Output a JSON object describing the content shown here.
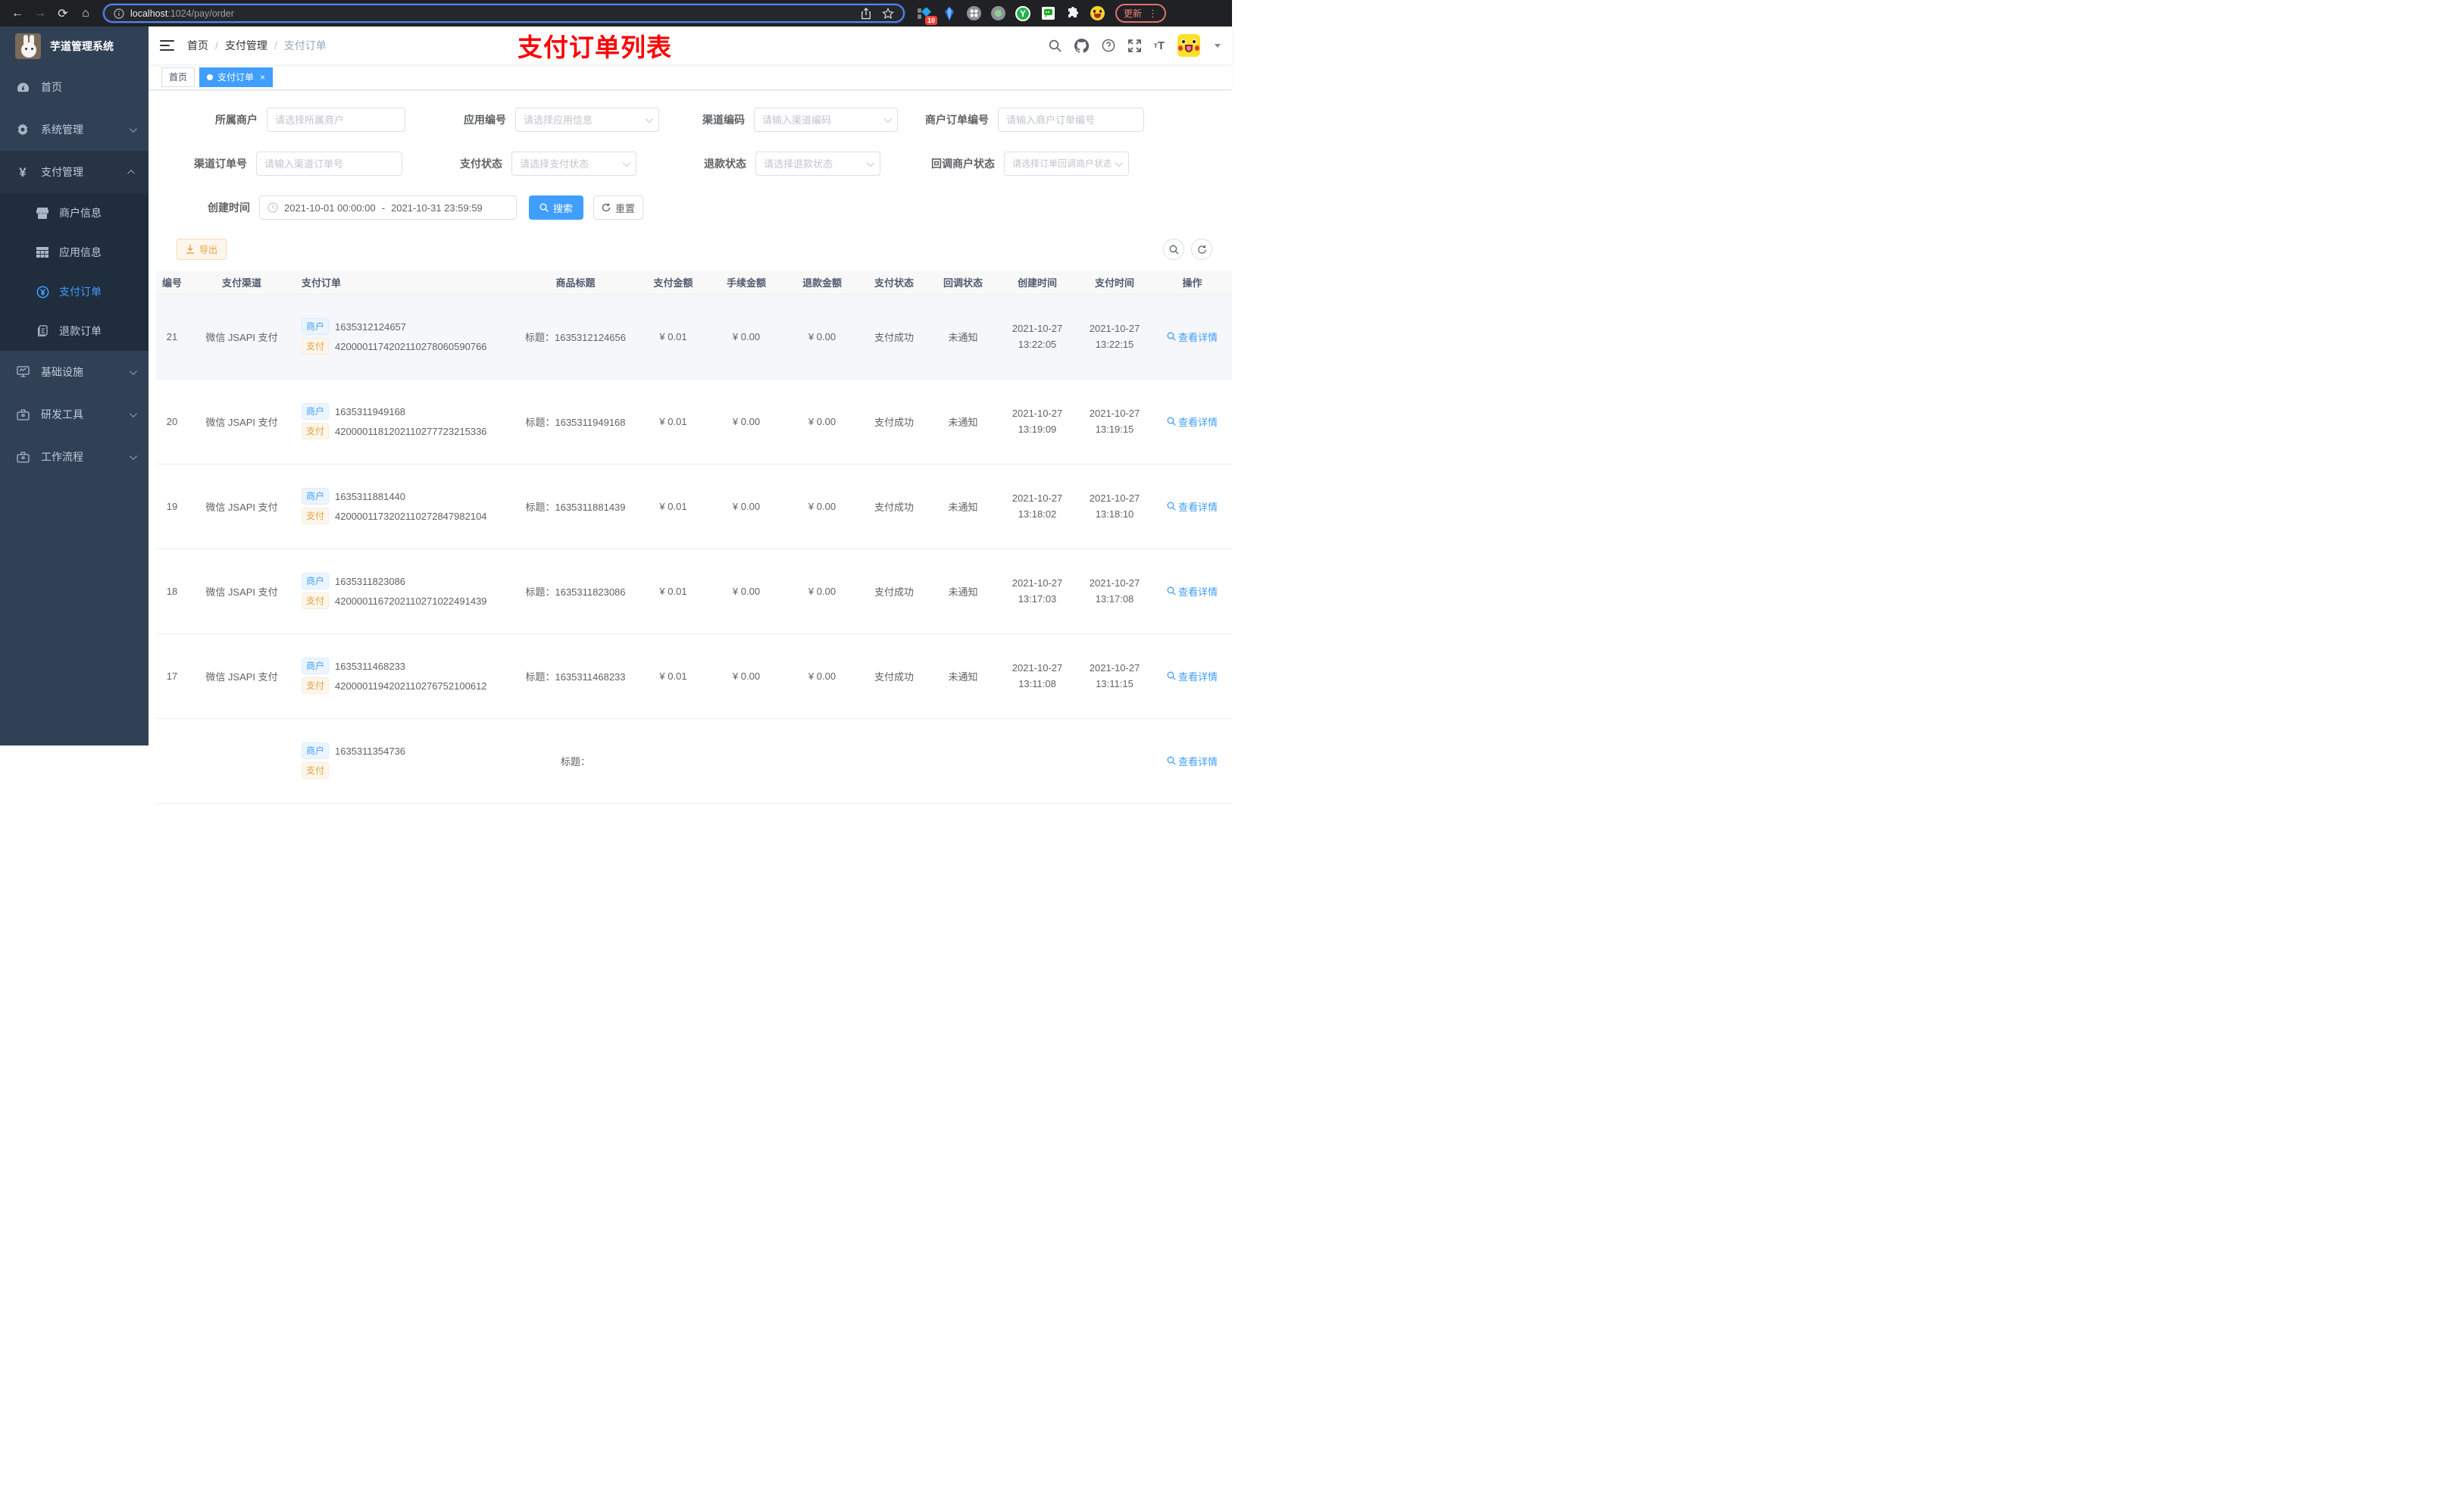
{
  "browser": {
    "url_host": "localhost",
    "url_rest": ":1024/pay/order",
    "extension_badge": "10",
    "update_label": "更新",
    "extension_icons": [
      "diamond-badge",
      "gem",
      "clover",
      "record-dot",
      "y-circle",
      "chat",
      "puzzle",
      "emoji-face"
    ]
  },
  "sidebar": {
    "logo_title": "芋道管理系统",
    "menu": [
      {
        "label": "首页",
        "icon": "dashboard-icon"
      },
      {
        "label": "系统管理",
        "icon": "gear-icon"
      },
      {
        "label": "支付管理",
        "icon": "yen-icon"
      },
      {
        "label": "商户信息",
        "icon": "shop-icon"
      },
      {
        "label": "应用信息",
        "icon": "grid-icon"
      },
      {
        "label": "支付订单",
        "icon": "pay-circle-icon"
      },
      {
        "label": "退款订单",
        "icon": "document-icon"
      },
      {
        "label": "基础设施",
        "icon": "monitor-icon"
      },
      {
        "label": "研发工具",
        "icon": "briefcase-icon"
      },
      {
        "label": "工作流程",
        "icon": "briefcase-icon"
      }
    ]
  },
  "header": {
    "breadcrumb": [
      "首页",
      "支付管理",
      "支付订单"
    ],
    "breadcrumb_sep": "/",
    "annotation": "支付订单列表",
    "right_icons": [
      "search-icon",
      "github-icon",
      "help-icon",
      "fullscreen-icon",
      "font-size-icon",
      "avatar",
      "caret-down-icon"
    ]
  },
  "tabs": [
    {
      "label": "首页",
      "active": false
    },
    {
      "label": "支付订单",
      "active": true,
      "close": "×"
    }
  ],
  "filters": {
    "fields": [
      {
        "label": "所属商户",
        "placeholder": "请选择所属商户",
        "select": false
      },
      {
        "label": "应用编号",
        "placeholder": "请选择应用信息",
        "select": true
      },
      {
        "label": "渠道编码",
        "placeholder": "请输入渠道编码",
        "select": true
      },
      {
        "label": "商户订单编号",
        "placeholder": "请输入商户订单编号",
        "select": false
      },
      {
        "label": "渠道订单号",
        "placeholder": "请输入渠道订单号",
        "select": false
      },
      {
        "label": "支付状态",
        "placeholder": "请选择支付状态",
        "select": true
      },
      {
        "label": "退款状态",
        "placeholder": "请选择退款状态",
        "select": true
      },
      {
        "label": "回调商户状态",
        "placeholder": "请选择订单回调商户状态",
        "select": true
      }
    ],
    "date": {
      "label": "创建时间",
      "start": "2021-10-01 00:00:00",
      "separator": "-",
      "end": "2021-10-31 23:59:59"
    },
    "search_label": "搜索",
    "reset_label": "重置"
  },
  "toolbar": {
    "export_label": "导出"
  },
  "table": {
    "columns": [
      "编号",
      "支付渠道",
      "支付订单",
      "商品标题",
      "支付金额",
      "手续金额",
      "退款金额",
      "支付状态",
      "回调状态",
      "创建时间",
      "支付时间",
      "操作"
    ],
    "tag_merchant": "商户",
    "tag_pay": "支付",
    "title_prefix": "标题：",
    "action_label": "查看详情",
    "rows": [
      {
        "id": "21",
        "channel": "微信 JSAPI 支付",
        "merchant_no": "1635312124657",
        "pay_no": "4200001174202110278060590766",
        "title": "1635312124656",
        "amount": "¥ 0.01",
        "fee": "¥ 0.00",
        "refund": "¥ 0.00",
        "status": "支付成功",
        "notify": "未通知",
        "created_date": "2021-10-27",
        "created_time": "13:22:05",
        "paid_date": "2021-10-27",
        "paid_time": "13:22:15",
        "highlight": true
      },
      {
        "id": "20",
        "channel": "微信 JSAPI 支付",
        "merchant_no": "1635311949168",
        "pay_no": "4200001181202110277723215336",
        "title": "1635311949168",
        "amount": "¥ 0.01",
        "fee": "¥ 0.00",
        "refund": "¥ 0.00",
        "status": "支付成功",
        "notify": "未通知",
        "created_date": "2021-10-27",
        "created_time": "13:19:09",
        "paid_date": "2021-10-27",
        "paid_time": "13:19:15"
      },
      {
        "id": "19",
        "channel": "微信 JSAPI 支付",
        "merchant_no": "1635311881440",
        "pay_no": "4200001173202110272847982104",
        "title": "1635311881439",
        "amount": "¥ 0.01",
        "fee": "¥ 0.00",
        "refund": "¥ 0.00",
        "status": "支付成功",
        "notify": "未通知",
        "created_date": "2021-10-27",
        "created_time": "13:18:02",
        "paid_date": "2021-10-27",
        "paid_time": "13:18:10"
      },
      {
        "id": "18",
        "channel": "微信 JSAPI 支付",
        "merchant_no": "1635311823086",
        "pay_no": "4200001167202110271022491439",
        "title": "1635311823086",
        "amount": "¥ 0.01",
        "fee": "¥ 0.00",
        "refund": "¥ 0.00",
        "status": "支付成功",
        "notify": "未通知",
        "created_date": "2021-10-27",
        "created_time": "13:17:03",
        "paid_date": "2021-10-27",
        "paid_time": "13:17:08"
      },
      {
        "id": "17",
        "channel": "微信 JSAPI 支付",
        "merchant_no": "1635311468233",
        "pay_no": "4200001194202110276752100612",
        "title": "1635311468233",
        "amount": "¥ 0.01",
        "fee": "¥ 0.00",
        "refund": "¥ 0.00",
        "status": "支付成功",
        "notify": "未通知",
        "created_date": "2021-10-27",
        "created_time": "13:11:08",
        "paid_date": "2021-10-27",
        "paid_time": "13:11:15"
      },
      {
        "id": "",
        "channel": "",
        "merchant_no": "1635311354736",
        "pay_no": "",
        "title": "",
        "amount": "",
        "fee": "",
        "refund": "",
        "status": "",
        "notify": "",
        "created_date": "",
        "created_time": "",
        "paid_date": "",
        "paid_time": "",
        "partial": true
      }
    ]
  },
  "colors": {
    "accent": "#409eff",
    "warning": "#e6a23c",
    "annotation_red": "#fe0000",
    "sidebar_bg": "#304156",
    "sidebar_submenu_bg": "#1f2d3d",
    "active_tab_bg": "#409eff"
  }
}
